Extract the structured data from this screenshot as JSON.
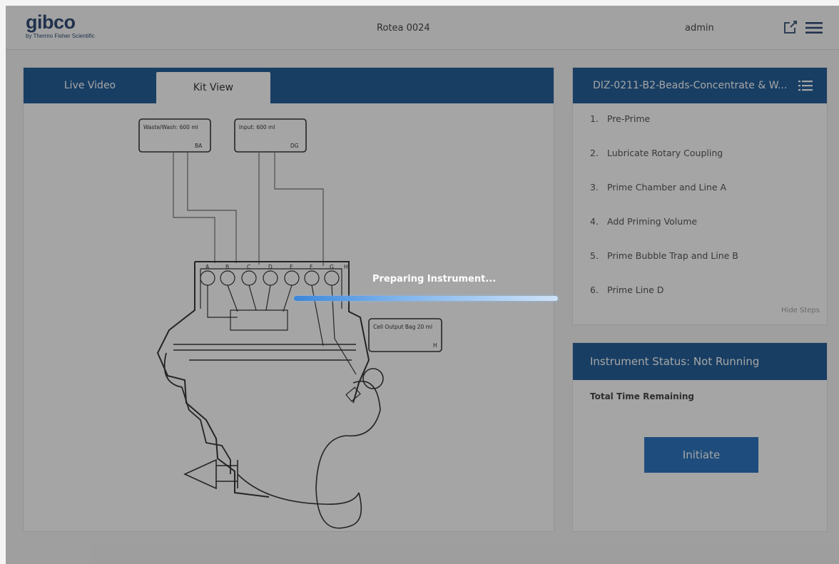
{
  "header": {
    "logo_main": "gibco",
    "logo_sub": "by Thermo Fisher Scientific",
    "instrument_name": "Rotea 0024",
    "user": "admin"
  },
  "tabs": [
    {
      "label": "Live Video",
      "active": false
    },
    {
      "label": "Kit View",
      "active": true
    }
  ],
  "kit_diagram": {
    "bag_waste_wash": "Waste/Wash: 600 ml",
    "bag_waste_wash_ports": "BA",
    "bag_input": "Input: 600 ml",
    "bag_input_ports": "DG",
    "bag_cell_output": "Cell Output Bag 20 ml",
    "bag_cell_output_port": "H",
    "valve_labels": [
      "A",
      "B",
      "C",
      "D",
      "E",
      "F",
      "G",
      "H"
    ]
  },
  "protocol": {
    "title": "DIZ-0211-B2-Beads-Concentrate & W...",
    "steps": [
      {
        "num": "1.",
        "label": "Pre-Prime"
      },
      {
        "num": "2.",
        "label": "Lubricate Rotary Coupling"
      },
      {
        "num": "3.",
        "label": "Prime Chamber and Line A"
      },
      {
        "num": "4.",
        "label": "Add Priming Volume"
      },
      {
        "num": "5.",
        "label": "Prime Bubble Trap and Line B"
      },
      {
        "num": "6.",
        "label": "Prime Line D"
      }
    ],
    "hide_steps": "Hide Steps"
  },
  "status": {
    "title": "Instrument Status: Not Running",
    "time_remaining_label": "Total Time Remaining",
    "initiate_label": "Initiate"
  },
  "overlay": {
    "message": "Preparing Instrument..."
  },
  "colors": {
    "brand_blue": "#0d4f8f",
    "button_blue": "#1767b8"
  }
}
